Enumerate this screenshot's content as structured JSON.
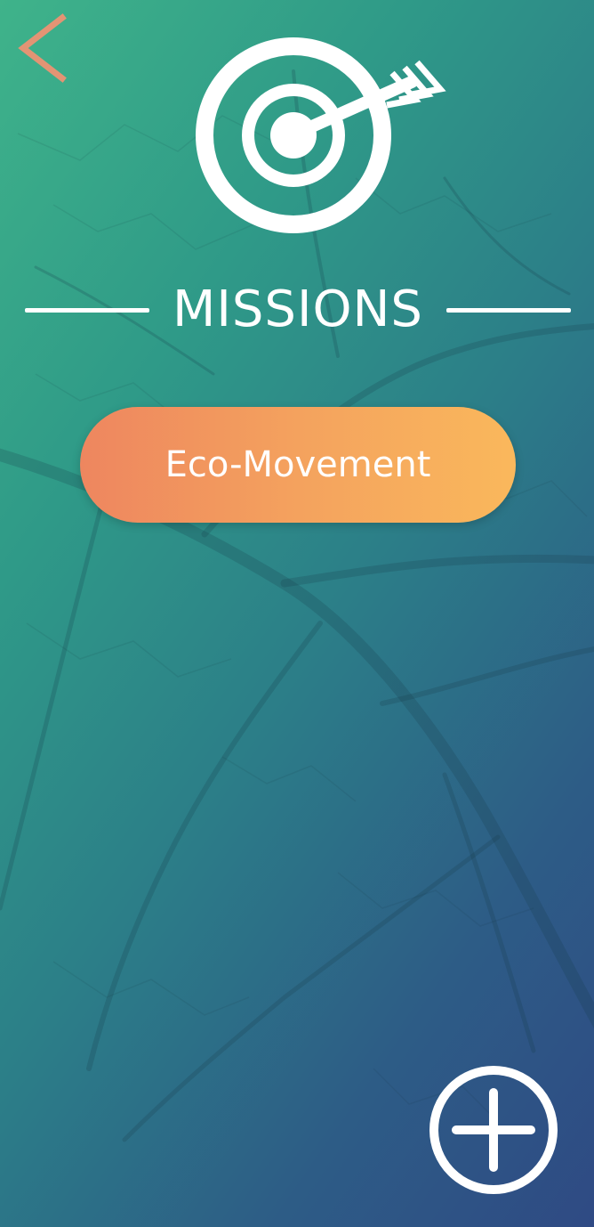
{
  "app": {
    "title": "MISSIONS"
  },
  "header": {
    "back_icon": "chevron-left-icon",
    "hero_icon": "target-arrow-icon"
  },
  "missions": [
    {
      "label": "Eco-Movement"
    }
  ],
  "fab": {
    "icon": "plus-circle-icon"
  },
  "colors": {
    "background_start": "#3fb38a",
    "background_end": "#2f4a84",
    "accent_back": "#e39474",
    "button_start": "#ee865f",
    "button_end": "#fab85c",
    "foreground": "#ffffff"
  }
}
